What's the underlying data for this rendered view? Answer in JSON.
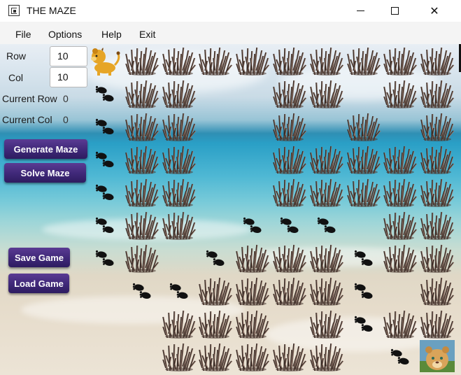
{
  "window": {
    "title": "THE MAZE",
    "minimize_icon": "minimize-icon",
    "maximize_icon": "maximize-icon",
    "close_glyph": "✕"
  },
  "menu": {
    "items": [
      "File",
      "Options",
      "Help",
      "Exit"
    ]
  },
  "controls": {
    "row_label": "Row",
    "row_value": "10",
    "col_label": "Col",
    "col_value": "10",
    "current_row_label": "Current Row",
    "current_row_value": "0",
    "current_col_label": "Current Col",
    "current_col_value": "0",
    "generate_label": "Generate Maze",
    "solve_label": "Solve Maze",
    "save_label": "Save Game",
    "load_label": "Load Game"
  },
  "maze": {
    "rows": 10,
    "cols": 10,
    "legend": {
      "W": "thorn-wall-icon",
      "F": "footprint-icon",
      "S": "simba-player-icon",
      "N": "nala-goal-icon",
      ".": "empty"
    },
    "grid": [
      "SWWWWWWWWW",
      "FWW..WW.WW",
      "FWW..W.W.W",
      "FWW..WWWWW",
      "FWW..WWWWW",
      "FWW.FFF.WW",
      "FW.FWWWFWW",
      ".FFWWWWF.W",
      "..WWW.WFWW",
      "..WWWWW.FN"
    ]
  }
}
